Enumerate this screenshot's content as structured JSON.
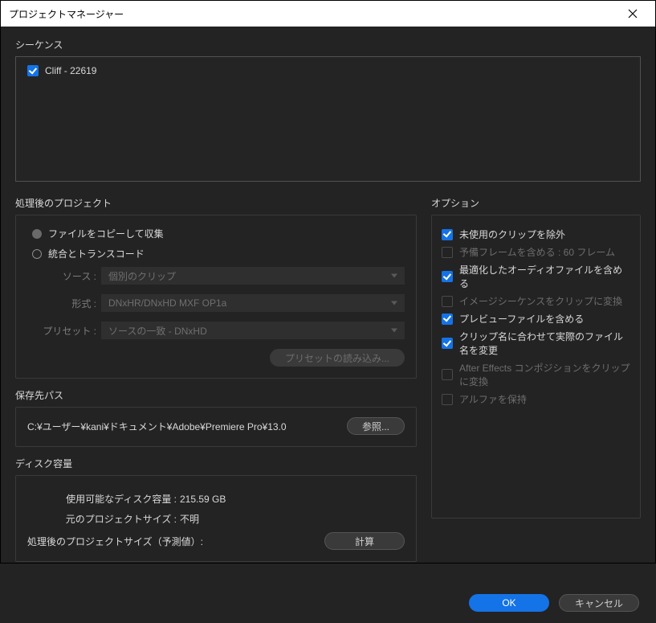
{
  "window_title": "プロジェクトマネージャー",
  "sequence": {
    "label": "シーケンス",
    "items": [
      {
        "name": "Cliff - 22619",
        "checked": true
      }
    ]
  },
  "processed": {
    "label": "処理後のプロジェクト",
    "radio_copy": "ファイルをコピーして収集",
    "radio_transcode": "統合とトランスコード",
    "source_label": "ソース :",
    "source_value": "個別のクリップ",
    "format_label": "形式 :",
    "format_value": "DNxHR/DNxHD MXF OP1a",
    "preset_label": "プリセット :",
    "preset_value": "ソースの一致 - DNxHD",
    "load_preset_btn": "プリセットの読み込み..."
  },
  "dest": {
    "label": "保存先パス",
    "path": "C:¥ユーザー¥kani¥ドキュメント¥Adobe¥Premiere Pro¥13.0",
    "browse": "参照..."
  },
  "disk": {
    "label": "ディスク容量",
    "avail_label": "使用可能なディスク容量 :",
    "avail_value": "215.59 GB",
    "orig_label": "元のプロジェクトサイズ :",
    "orig_value": "不明",
    "est_label": "処理後のプロジェクトサイズ（予測値）:",
    "calc_btn": "計算"
  },
  "options": {
    "label": "オプション",
    "items": [
      {
        "label": "未使用のクリップを除外",
        "checked": true,
        "enabled": true
      },
      {
        "label": "予備フレームを含める :   60 フレーム",
        "checked": false,
        "enabled": false
      },
      {
        "label": "最適化したオーディオファイルを含める",
        "checked": true,
        "enabled": true
      },
      {
        "label": "イメージシーケンスをクリップに変換",
        "checked": false,
        "enabled": false
      },
      {
        "label": "プレビューファイルを含める",
        "checked": true,
        "enabled": true
      },
      {
        "label": "クリップ名に合わせて実際のファイル名を変更",
        "checked": true,
        "enabled": true
      },
      {
        "label": "After Effects コンポジションをクリップに変換",
        "checked": false,
        "enabled": false
      },
      {
        "label": "アルファを保持",
        "checked": false,
        "enabled": false
      }
    ]
  },
  "footer": {
    "ok": "OK",
    "cancel": "キャンセル"
  }
}
